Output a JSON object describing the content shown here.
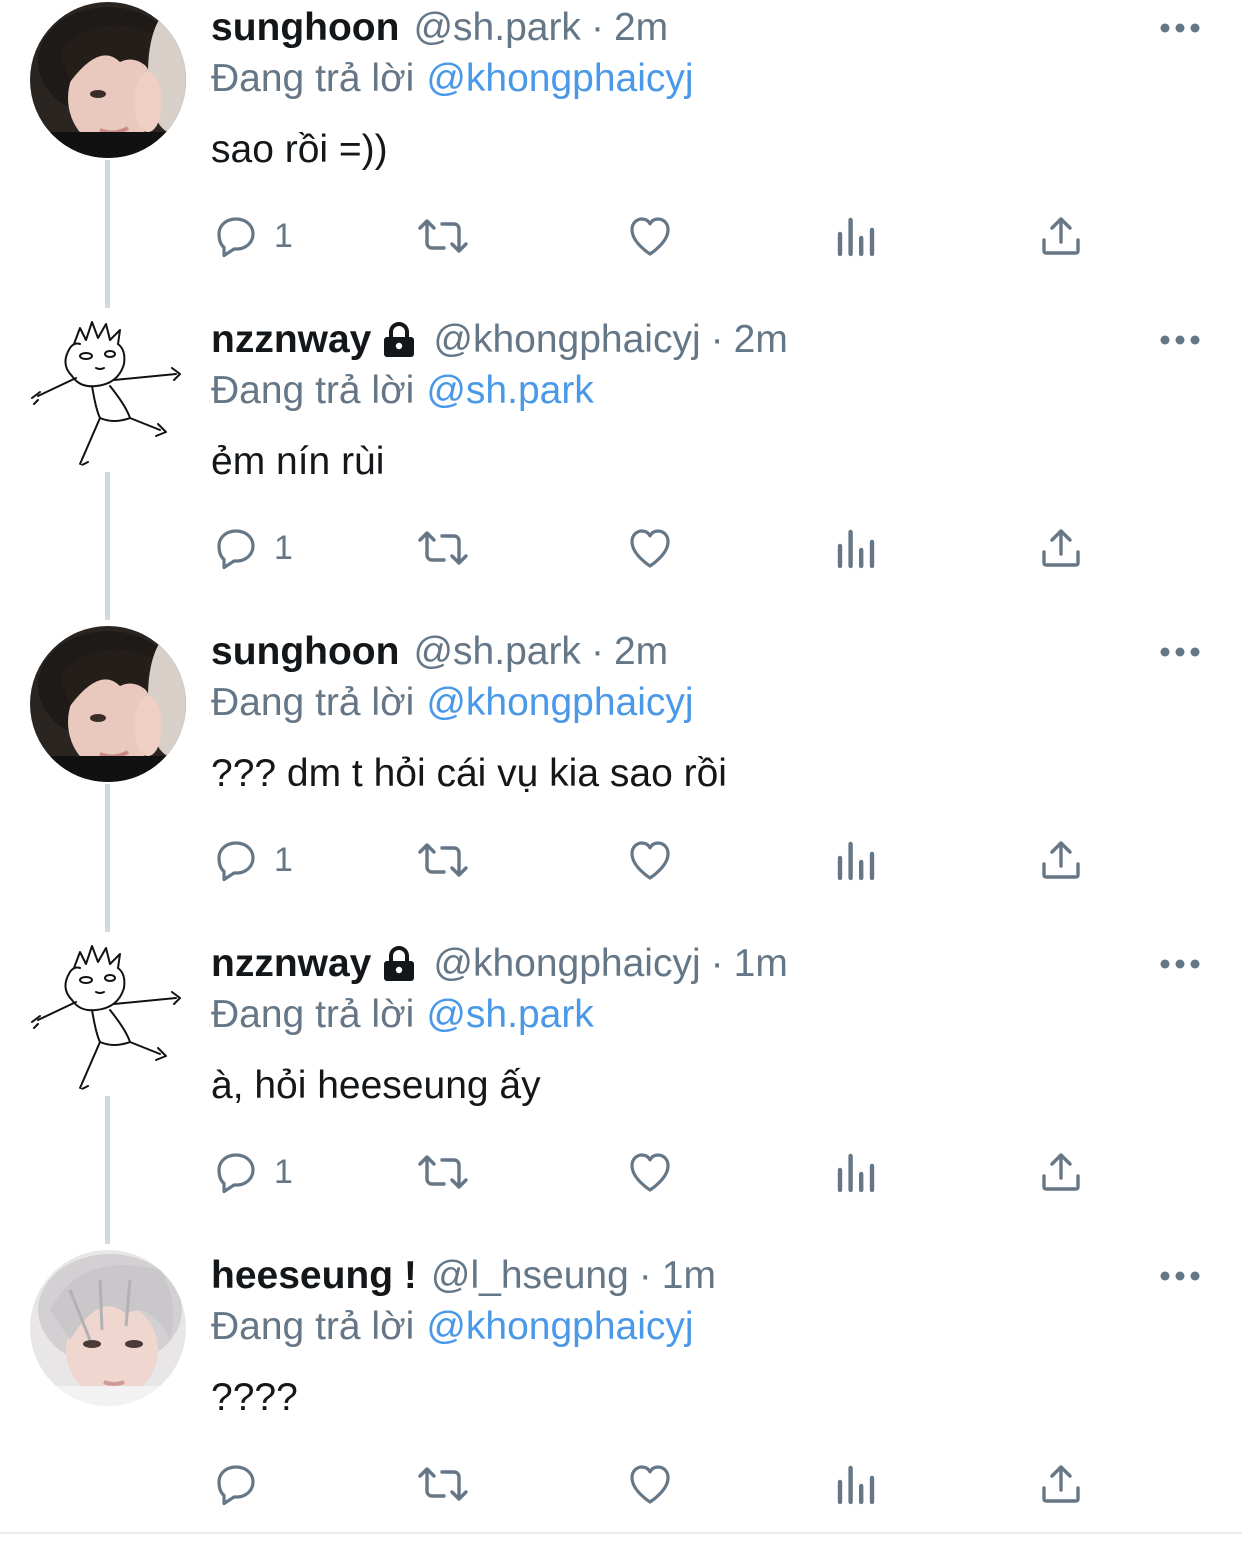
{
  "tweets": [
    {
      "name": "sunghoon",
      "handle": "@sh.park",
      "separator": "·",
      "time": "2m",
      "reply_prefix": "Đang trả lời",
      "reply_to": "@khongphaicyj",
      "text": "sao rồi =))",
      "reply_count": "1",
      "locked": false,
      "avatar": "photo-avatar"
    },
    {
      "name": "nzznway",
      "handle": "@khongphaicyj",
      "separator": "·",
      "time": "2m",
      "reply_prefix": "Đang trả lời",
      "reply_to": "@sh.park",
      "text": "ẻm nín rùi",
      "reply_count": "1",
      "locked": true,
      "avatar": "doodle-avatar"
    },
    {
      "name": "sunghoon",
      "handle": "@sh.park",
      "separator": "·",
      "time": "2m",
      "reply_prefix": "Đang trả lời",
      "reply_to": "@khongphaicyj",
      "text": "??? dm t hỏi cái vụ kia sao rồi",
      "reply_count": "1",
      "locked": false,
      "avatar": "photo-avatar"
    },
    {
      "name": "nzznway",
      "handle": "@khongphaicyj",
      "separator": "·",
      "time": "1m",
      "reply_prefix": "Đang trả lời",
      "reply_to": "@sh.park",
      "text": "à, hỏi heeseung ấy",
      "reply_count": "1",
      "locked": true,
      "avatar": "doodle-avatar"
    },
    {
      "name": "heeseung !",
      "handle": "@l_hseung",
      "separator": "·",
      "time": "1m",
      "reply_prefix": "Đang trả lời",
      "reply_to": "@khongphaicyj",
      "text": "????",
      "reply_count": "",
      "locked": false,
      "avatar": "light-hair-photo-avatar"
    }
  ],
  "icons": {
    "reply": "reply-icon",
    "retweet": "retweet-icon",
    "like": "like-icon",
    "analytics": "analytics-icon",
    "share": "share-icon",
    "more": "more-icon",
    "lock": "lock-icon"
  },
  "colors": {
    "text": "#14171a",
    "secondary": "#657786",
    "mention": "#4a99e9",
    "icon": "#657786",
    "connector": "#cfd9de"
  }
}
